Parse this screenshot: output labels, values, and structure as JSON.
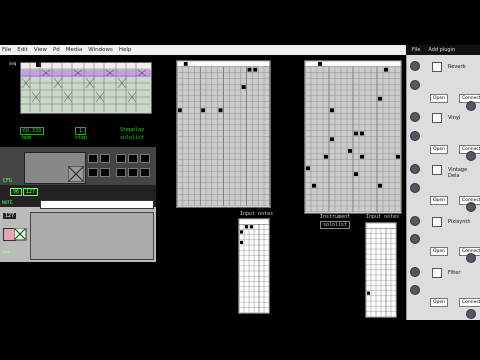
{
  "menu": {
    "items": [
      "File",
      "Edit",
      "View",
      "Pd",
      "Media",
      "Windows",
      "Help"
    ]
  },
  "side_title": {
    "items": [
      "File",
      "Add plugin"
    ]
  },
  "tempo": {
    "value": "60.330",
    "label": "bpm"
  },
  "step": {
    "value": "1",
    "label": "step"
  },
  "mode": {
    "line1": "Stepplay",
    "line2": "sololist"
  },
  "cfg": {
    "label": "CFG"
  },
  "seq_labels": {
    "a": "96",
    "b": "127",
    "c": "NOTE"
  },
  "small_field": {
    "value": "127"
  },
  "input_notes_1": {
    "label": "Input notes"
  },
  "input_notes_2": {
    "label": "Input notes"
  },
  "instrument": {
    "label": "Instrument",
    "value": "sololist"
  },
  "plugins": [
    {
      "name": "Reverb",
      "open": "Open",
      "connect": "Connecti"
    },
    {
      "name": "Vinyl",
      "open": "Open",
      "connect": "Connecti"
    },
    {
      "name": "Vintage Dela",
      "open": "Open",
      "connect": "Connecti"
    },
    {
      "name": "Pixisynth",
      "open": "Open",
      "connect": "Connecti"
    },
    {
      "name": "Filter",
      "open": "Open",
      "connect": "Connecti"
    }
  ]
}
